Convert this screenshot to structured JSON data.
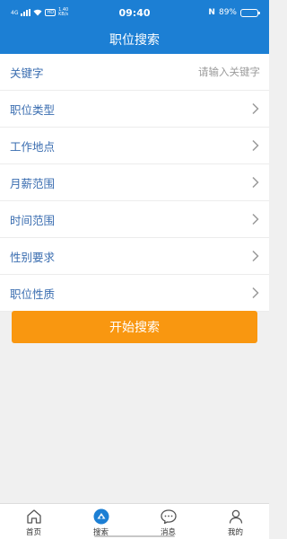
{
  "status_bar": {
    "network": "4G",
    "hd_badge": "HD",
    "speed_value": "1.40",
    "speed_unit": "KB/s",
    "time": "09:40",
    "nfc": "N",
    "battery": "89%",
    "battery_level": 0.89
  },
  "header": {
    "title": "职位搜索"
  },
  "form": {
    "keyword_label": "关键字",
    "keyword_placeholder": "请输入关键字",
    "rows": [
      {
        "label": "职位类型"
      },
      {
        "label": "工作地点"
      },
      {
        "label": "月薪范围"
      },
      {
        "label": "时间范围"
      },
      {
        "label": "性别要求"
      },
      {
        "label": "职位性质"
      }
    ]
  },
  "search_button": {
    "label": "开始搜索"
  },
  "tabbar": {
    "items": [
      {
        "label": "首页",
        "icon": "home-icon"
      },
      {
        "label": "搜索",
        "icon": "search-icon",
        "active": true
      },
      {
        "label": "消息",
        "icon": "message-icon"
      },
      {
        "label": "我的",
        "icon": "user-icon"
      }
    ]
  },
  "colors": {
    "primary": "#1c7fd4",
    "accent": "#f99710",
    "label": "#3a6db0"
  }
}
